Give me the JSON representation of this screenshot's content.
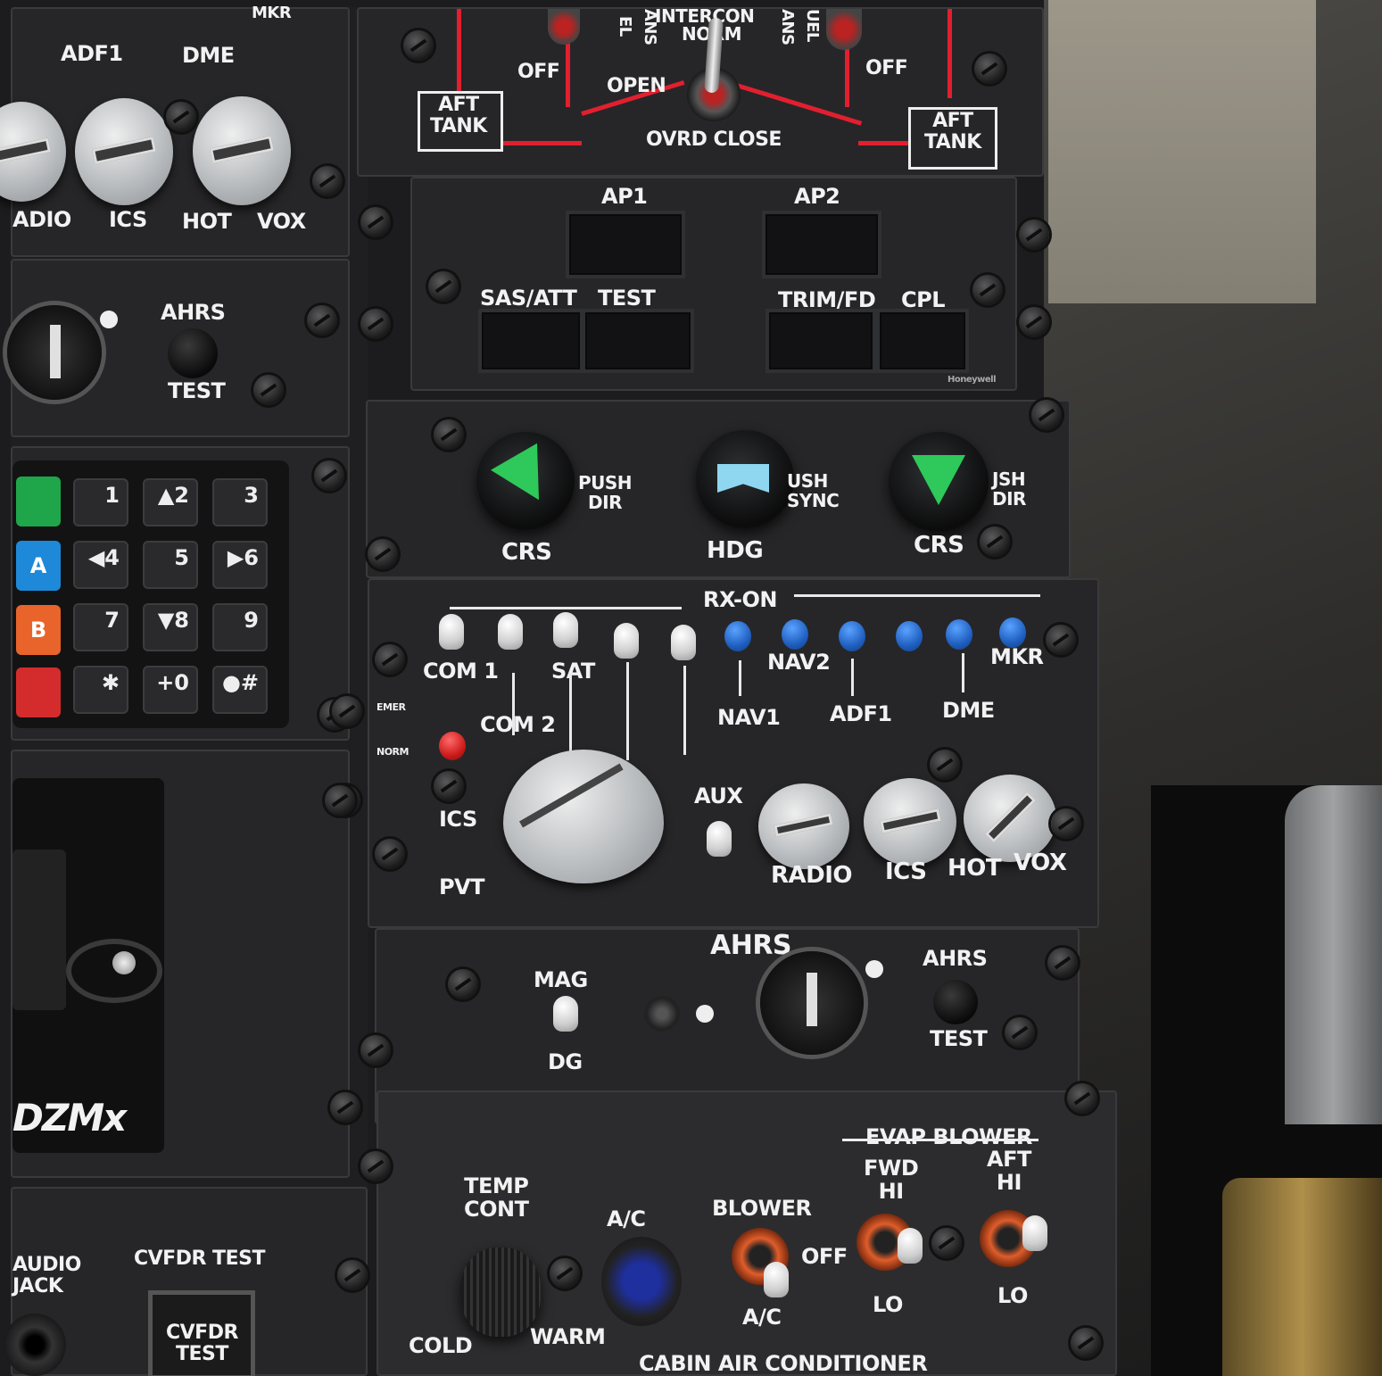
{
  "top_fuel_panel": {
    "aft_tank_left": "AFT\nTANK",
    "aft_tank_right": "AFT\nTANK",
    "off_left": "OFF",
    "off_right": "OFF",
    "open": "OPEN",
    "ovrd_close": "OVRD CLOSE",
    "interconn": "INTERCON",
    "norm": "NORM",
    "trans_left": "ANS",
    "fuel_left": "EL",
    "trans_right": "ANS",
    "fuel_right": "UEL"
  },
  "autopilot_panel": {
    "ap1": "AP1",
    "ap2": "AP2",
    "sas_att": "SAS/ATT",
    "test": "TEST",
    "trim_fd": "TRIM/FD",
    "cpl": "CPL",
    "brand": "Honeywell"
  },
  "course_panel": {
    "crs_left": "CRS",
    "hdg": "HDG",
    "crs_right": "CRS",
    "push_dir_left": "PUSH\nDIR",
    "push_sync": "USH\nSYNC",
    "push_dir_right": "JSH\nDIR"
  },
  "audio_panel": {
    "rx_on": "RX-ON",
    "com1": "COM 1",
    "com2": "COM 2",
    "sat": "SAT",
    "nav1": "NAV1",
    "nav2": "NAV2",
    "adf1": "ADF1",
    "dme": "DME",
    "mkr": "MKR",
    "emer": "EMER",
    "norm": "NORM",
    "ics": "ICS",
    "pvt": "PVT",
    "aux": "AUX",
    "radio": "RADIO",
    "ics_knob": "ICS",
    "hot": "HOT",
    "vox": "VOX"
  },
  "ahrs_panel": {
    "ahrs": "AHRS",
    "mag": "MAG",
    "dg": "DG",
    "ahrs_test_top": "AHRS",
    "ahrs_test_bottom": "TEST"
  },
  "aircon_panel": {
    "temp_cont": "TEMP\nCONT",
    "cold": "COLD",
    "warm": "WARM",
    "ac": "A/C",
    "blower": "BLOWER",
    "off": "OFF",
    "ac_bottom": "A/C",
    "evap_blower": "EVAP BLOWER",
    "fwd_hi": "FWD\nHI",
    "aft_hi": "AFT\nHI",
    "lo_left": "LO",
    "lo_right": "LO",
    "cabin_air": "CABIN AIR CONDITIONER"
  },
  "left_upper_audio": {
    "adf1": "ADF1",
    "dme": "DME",
    "mkr": "MKR",
    "radio": "ADIO",
    "ics": "ICS",
    "hot": "HOT",
    "vox": "VOX"
  },
  "left_ahrs": {
    "ahrs": "AHRS",
    "test": "TEST"
  },
  "keypad": {
    "keys": [
      "1",
      "▲2",
      "3",
      "◀4",
      "5",
      "▶6",
      "7",
      "▼8",
      "9",
      "✱",
      "+0",
      "●#"
    ],
    "a_label": "A",
    "b_label": "B"
  },
  "left_lower": {
    "brand": "DZMx",
    "audio_jack": "AUDIO\nJACK",
    "cvfdr_test": "CVFDR TEST",
    "cvfdr_button": "CVFDR\nTEST"
  },
  "colors": {
    "panel": "#262628",
    "label": "#f2f2f2",
    "green_pointer": "#2ec95a",
    "cyan_pointer": "#8fd6f0",
    "blue_toggle": "#1f5fbf",
    "red_line": "#e21f2f"
  }
}
